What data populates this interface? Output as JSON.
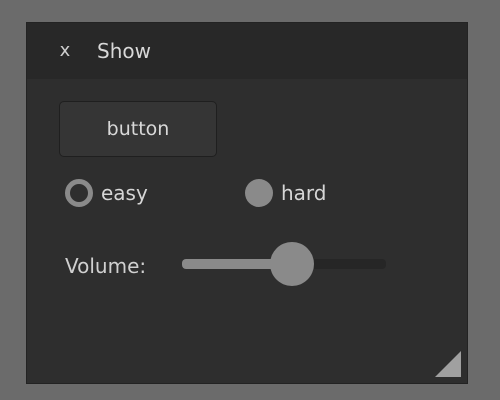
{
  "window": {
    "title": "Show",
    "close_label": "x"
  },
  "button": {
    "label": "button"
  },
  "radios": [
    {
      "label": "easy",
      "checked": true
    },
    {
      "label": "hard",
      "checked": false
    }
  ],
  "volume": {
    "label": "Volume:",
    "value": 0.54
  },
  "colors": {
    "background": "#6b6b6b",
    "panel": "#2e2e2e",
    "titlebar": "#282828",
    "accent": "#8a8a8a",
    "text": "#d6d6d6"
  }
}
